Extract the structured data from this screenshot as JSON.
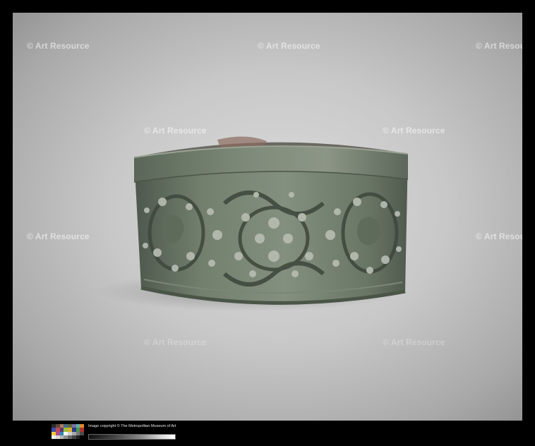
{
  "watermark": {
    "text": "© Art Resource"
  },
  "footer": {
    "copyright": "Image copyright © The Metropolitan Museum of Art",
    "swatch_colors": [
      "#2b2b2b",
      "#5d4a3a",
      "#b07a5c",
      "#4a6a8a",
      "#5a6b3a",
      "#7a6ea0",
      "#5fb0a8",
      "#e08a30",
      "#3e4ea8",
      "#c04a5a",
      "#5a3a6a",
      "#9ac040",
      "#e0b030",
      "#2a3a8a",
      "#4a9a4a",
      "#b03030",
      "#f0d040",
      "#b04a90",
      "#2a8ab0",
      "#f5f5f5",
      "#cfcfcf",
      "#a8a8a8",
      "#7a7a7a",
      "#4a4a4a",
      "#f0f0f0",
      "#d8d8d8",
      "#b8b8b8",
      "#909090",
      "#686868",
      "#444444",
      "#222222",
      "#000000"
    ]
  },
  "object_palette": {
    "bronze_dark": "#4f5c4f",
    "bronze_mid": "#6d7a68",
    "bronze_light": "#8a9585",
    "patina": "#7d8f80",
    "background": "#c8c8c8"
  }
}
